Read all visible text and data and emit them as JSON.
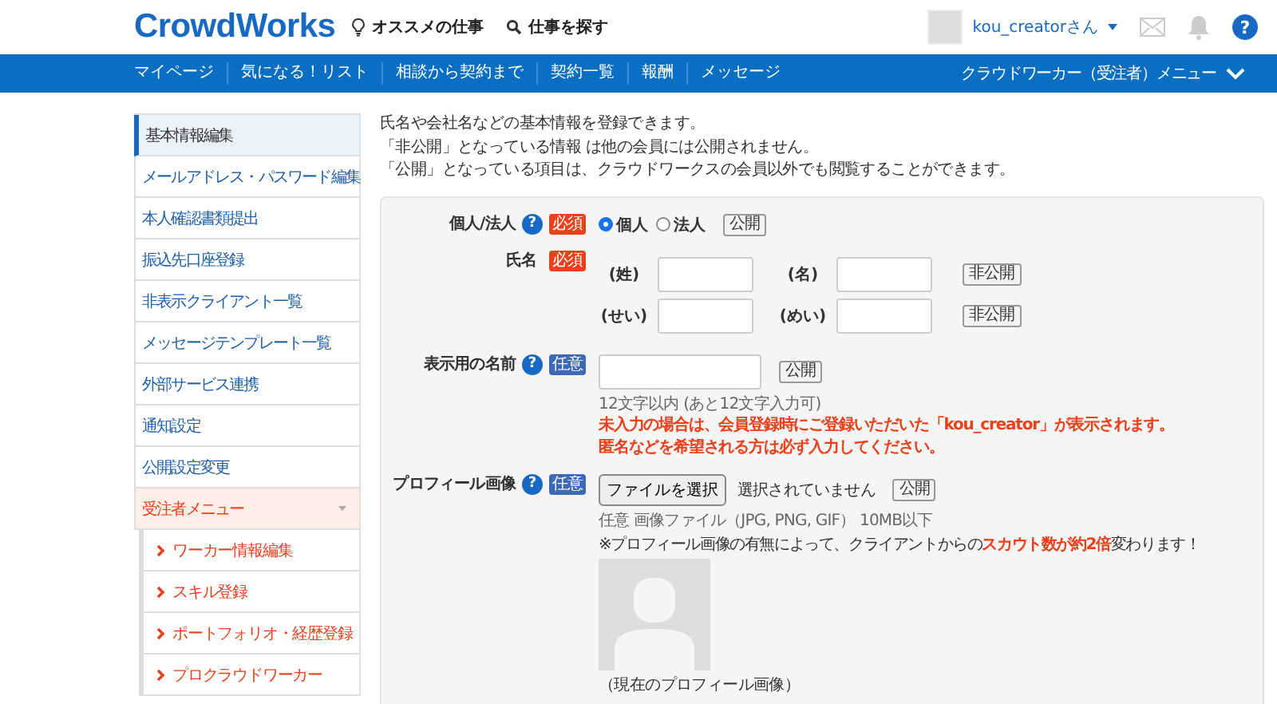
{
  "header": {
    "logo": "CrowdWorks",
    "links": [
      {
        "kind": "bulb",
        "label": "オススメの仕事"
      },
      {
        "kind": "search",
        "label": "仕事を探す"
      }
    ],
    "user": "kou_creatorさん",
    "help": "?"
  },
  "nav": {
    "items": [
      "マイページ",
      "気になる！リスト",
      "相談から契約まで",
      "契約一覧",
      "報酬",
      "メッセージ"
    ],
    "menu": "クラウドワーカー（受注者）メニュー"
  },
  "sidebar": {
    "items": [
      {
        "label": "基本情報編集",
        "selected": true
      },
      {
        "label": "メールアドレス・パスワード編集",
        "selected": false
      },
      {
        "label": "本人確認書類提出",
        "selected": false
      },
      {
        "label": "振込先口座登録",
        "selected": false
      },
      {
        "label": "非表示クライアント一覧",
        "selected": false
      },
      {
        "label": "メッセージテンプレート一覧",
        "selected": false
      },
      {
        "label": "外部サービス連携",
        "selected": false
      },
      {
        "label": "通知設定",
        "selected": false
      },
      {
        "label": "公開設定変更",
        "selected": false
      },
      {
        "label": "受注者メニュー",
        "selected": false,
        "expanded": true,
        "children": [
          {
            "label": "ワーカー情報編集"
          },
          {
            "label": "スキル登録"
          },
          {
            "label": "ポートフォリオ・経歴登録"
          },
          {
            "label": "プロクラウドワーカー"
          }
        ]
      }
    ]
  },
  "intro": [
    "氏名や会社名などの基本情報を登録できます。",
    "「非公開」となっている情報 は他の会員には公開されません。",
    "「公開」となっている項目は、クラウドワークスの会員以外でも閲覧することができます。"
  ],
  "form": [
    {
      "kind": "choice",
      "label": "個人/法人",
      "help": "?",
      "badge": {
        "label": "必須",
        "kind": "required"
      },
      "options": [
        {
          "label": "個人",
          "selected": true
        },
        {
          "label": "法人",
          "selected": false
        }
      ],
      "visibility": "公開"
    },
    {
      "kind": "name",
      "label": "氏名",
      "badge": {
        "label": "必須",
        "kind": "required"
      },
      "lines": [
        {
          "fields": [
            "(姓)",
            "(名)"
          ],
          "visibility": "非公開"
        },
        {
          "fields": [
            "(せい)",
            "(めい)"
          ],
          "visibility": "非公開"
        }
      ]
    },
    {
      "kind": "text",
      "label": "表示用の名前",
      "help": "?",
      "badge": {
        "label": "任意",
        "kind": "optional"
      },
      "visibility": "公開",
      "hint": "12文字以内 (あと12文字入力可)",
      "warnings": [
        "未入力の場合は、会員登録時にご登録いただいた「kou_creator」が表示されます。",
        "匿名などを希望される方は必ず入力してください。"
      ]
    },
    {
      "kind": "image",
      "label": "プロフィール画像",
      "help": "?",
      "badge": {
        "label": "任意",
        "kind": "optional"
      },
      "button": "ファイルを選択",
      "status": "選択されていません",
      "visibility": "公開",
      "hint": "任意 画像ファイル（JPG, PNG, GIF） 10MB以下",
      "note": "※プロフィール画像の有無によって、クライアントからの**スカウト数が約2倍**変わります！",
      "caption": "（現在のプロフィール画像）"
    }
  ]
}
